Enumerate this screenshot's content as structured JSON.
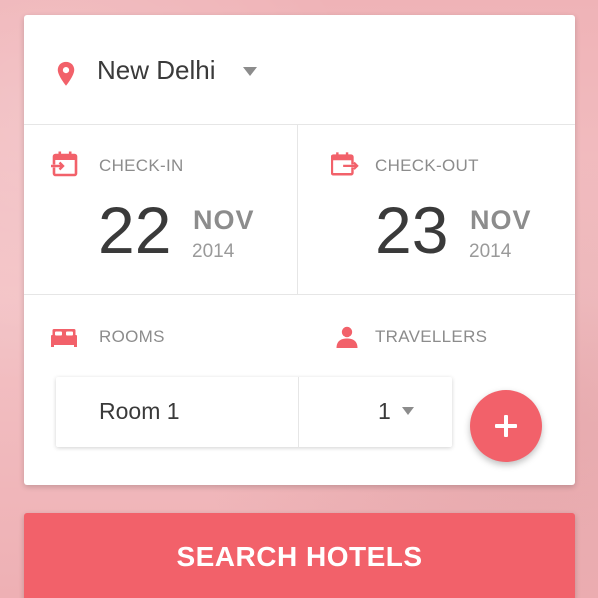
{
  "location": {
    "city": "New Delhi",
    "icon": "location-pin-icon"
  },
  "checkin": {
    "label": "CHECK-IN",
    "day": "22",
    "month": "NOV",
    "year": "2014",
    "icon": "calendar-checkin-icon"
  },
  "checkout": {
    "label": "CHECK-OUT",
    "day": "23",
    "month": "NOV",
    "year": "2014",
    "icon": "calendar-checkout-icon"
  },
  "rooms": {
    "label": "ROOMS",
    "value": "Room 1",
    "icon": "bed-icon"
  },
  "travellers": {
    "label": "TRAVELLERS",
    "value": "1",
    "icon": "person-icon"
  },
  "add_room": {
    "icon": "plus-icon"
  },
  "search": {
    "label": "SEARCH HOTELS"
  },
  "colors": {
    "accent": "#f2616a",
    "text_dark": "#3a3a3a",
    "text_muted": "#8c8c8c",
    "background": "#f0b6ba"
  }
}
